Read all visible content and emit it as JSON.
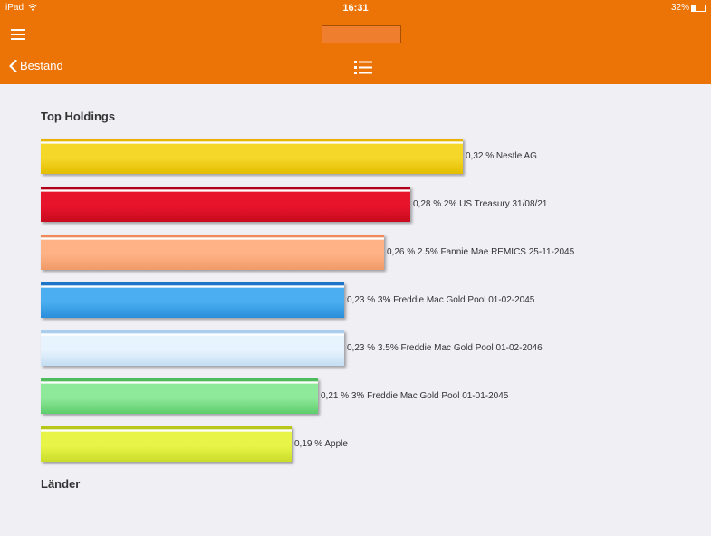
{
  "status_bar": {
    "carrier": "iPad",
    "time": "16:31",
    "battery": "32%",
    "battery_level": 0.32
  },
  "nav": {
    "back_label": "Bestand"
  },
  "sections": {
    "top_holdings_title": "Top Holdings",
    "countries_title": "Länder"
  },
  "holdings": [
    {
      "pct": 0.32,
      "label": "0,32 % Nestle AG",
      "color_top": "#e8b400",
      "color_mid": "#f5d72a",
      "color_bot": "#e3bd00"
    },
    {
      "pct": 0.28,
      "label": "0,28 % 2% US Treasury 31/08/21",
      "color_top": "#b3001a",
      "color_mid": "#e8142c",
      "color_bot": "#c80a1e"
    },
    {
      "pct": 0.26,
      "label": "0,26 % 2.5% Fannie Mae REMICS 25-11-2045",
      "color_top": "#f08a5a",
      "color_mid": "#ffb286",
      "color_bot": "#f09a68"
    },
    {
      "pct": 0.23,
      "label": "0,23 % 3% Freddie Mac Gold Pool 01-02-2045",
      "color_top": "#1e74c6",
      "color_mid": "#4aaef0",
      "color_bot": "#2a8edc"
    },
    {
      "pct": 0.23,
      "label": "0,23 % 3.5% Freddie Mac Gold Pool 01-02-2046",
      "color_top": "#a9cdec",
      "color_mid": "#e8f4fd",
      "color_bot": "#c4def3"
    },
    {
      "pct": 0.21,
      "label": "0,21 % 3% Freddie Mac Gold Pool 01-01-2045",
      "color_top": "#4ebc5c",
      "color_mid": "#8ee99a",
      "color_bot": "#5fcd6c"
    },
    {
      "pct": 0.19,
      "label": "0,19 % Apple",
      "color_top": "#b8c81a",
      "color_mid": "#e8f548",
      "color_bot": "#cadc2a"
    }
  ],
  "colors": {
    "accent": "#ec7306",
    "background": "#efeff4"
  },
  "icons": {
    "menu": "hamburger-icon",
    "back": "chevron-left-icon",
    "list": "list-icon",
    "wifi": "wifi-icon",
    "battery": "battery-icon"
  }
}
